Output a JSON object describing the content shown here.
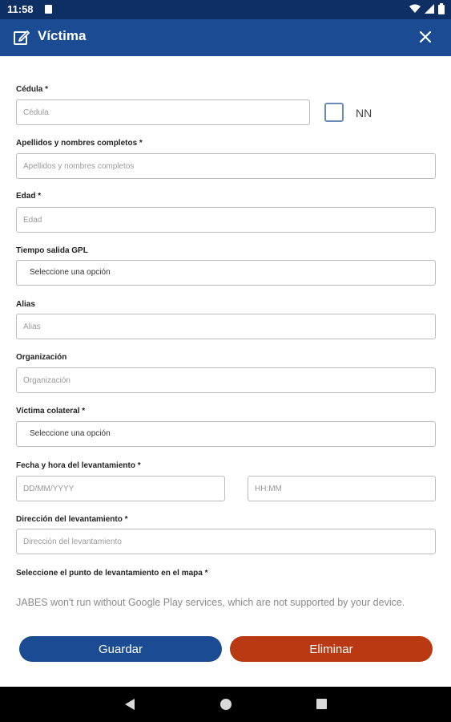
{
  "status_bar": {
    "time": "11:58"
  },
  "app_bar": {
    "title": "Víctima"
  },
  "form": {
    "cedula": {
      "label": "Cédula *",
      "placeholder": "Cédula"
    },
    "nn": {
      "label": "NN"
    },
    "nombres": {
      "label": "Apellidos y nombres completos *",
      "placeholder": "Apellidos y nombres completos"
    },
    "edad": {
      "label": "Edad *",
      "placeholder": "Edad"
    },
    "tiempo_salida": {
      "label": "Tiempo salida GPL",
      "value": "Seleccione una opción"
    },
    "alias": {
      "label": "Alias",
      "placeholder": "Alias"
    },
    "organizacion": {
      "label": "Organización",
      "placeholder": "Organización"
    },
    "victima_colateral": {
      "label": "Víctima colateral *",
      "value": "Seleccione una opción"
    },
    "fecha_hora": {
      "label": "Fecha y hora del levantamiento *",
      "date_placeholder": "DD/MM/YYYY",
      "time_placeholder": "HH:MM"
    },
    "direccion": {
      "label": "Dirección del levantamiento *",
      "placeholder": "Dirección del levantamiento"
    },
    "mapa": {
      "label": "Seleccione el punto de levantamiento en el mapa *",
      "notice": "JABES won't run without Google Play services, which are not supported by your device."
    }
  },
  "actions": {
    "save_label": "Guardar",
    "delete_label": "Eliminar"
  },
  "colors": {
    "status_bar": "#0d2f63",
    "app_bar": "#1a4b93",
    "save": "#1a4b93",
    "delete": "#b93a12"
  }
}
